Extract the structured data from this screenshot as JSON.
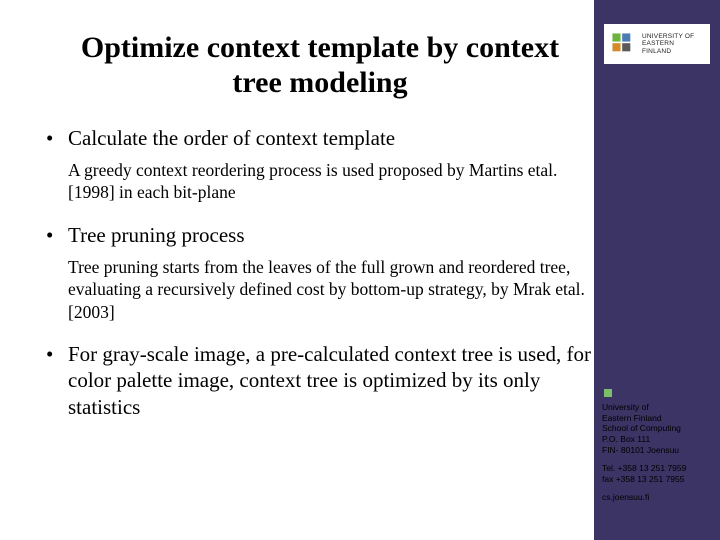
{
  "title": "Optimize context template by context tree modeling",
  "bullets": [
    {
      "head": "Calculate the order of context template",
      "sub": "A greedy context reordering process is used proposed by Martins etal. [1998]  in each bit-plane"
    },
    {
      "head": "Tree pruning process",
      "sub": "Tree pruning starts from the leaves of the full grown and reordered tree, evaluating a recursively defined cost  by bottom-up strategy, by Mrak etal. [2003]"
    },
    {
      "head": "For gray-scale image, a pre-calculated context tree is used, for color palette image, context tree is optimized by its only statistics",
      "sub": ""
    }
  ],
  "logo": {
    "line1": "UNIVERSITY OF",
    "line2": "EASTERN FINLAND"
  },
  "contact": {
    "org": "University of\nEastern Finland\nSchool of Computing\nP.O. Box 111\nFIN- 80101 Joensuu",
    "phones": "Tel. +358 13 251 7959\nfax +358 13 251 7955",
    "web": "cs.joensuu.fi"
  }
}
